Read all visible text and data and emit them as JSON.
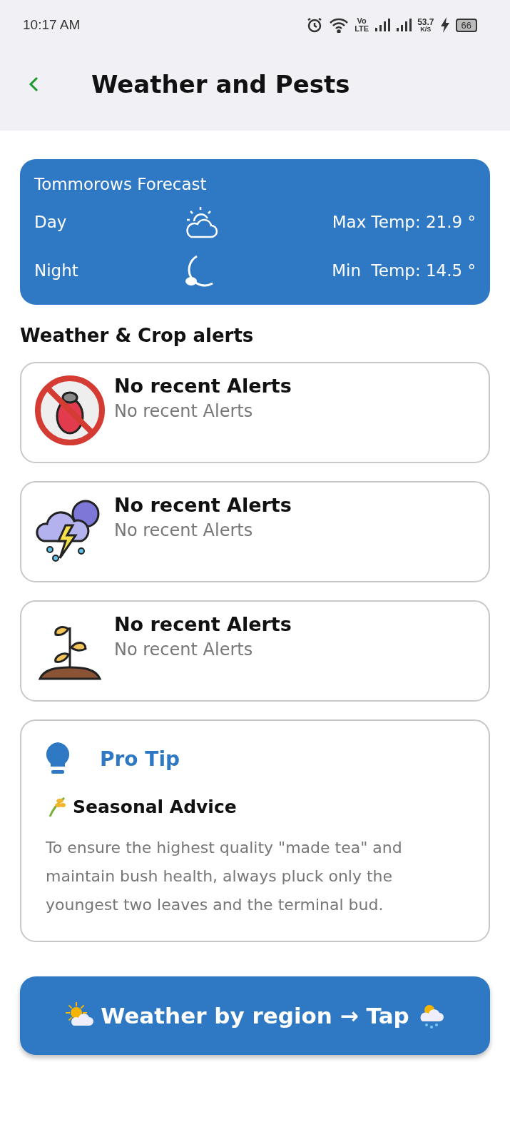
{
  "status_bar": {
    "time": "10:17 AM",
    "network_top": "Vo",
    "network_bottom": "LTE",
    "speed": "53.7",
    "speed_unit": "K/S",
    "battery": "66"
  },
  "header": {
    "title": "Weather and Pests"
  },
  "forecast": {
    "title": "Tommorows Forecast",
    "rows": [
      {
        "kind": "day",
        "label": "Day",
        "reading": "Max Temp: 21.9 °"
      },
      {
        "kind": "night",
        "label": "Night",
        "reading": "Min  Temp: 14.5 °"
      }
    ]
  },
  "alerts_title": "Weather & Crop alerts",
  "alerts": [
    {
      "kind": "pest",
      "title": "No recent Alerts",
      "subtitle": "No recent Alerts"
    },
    {
      "kind": "storm",
      "title": "No recent Alerts",
      "subtitle": "No recent Alerts"
    },
    {
      "kind": "plant",
      "title": "No recent Alerts",
      "subtitle": "No recent Alerts"
    }
  ],
  "pro_tip": {
    "title": "Pro Tip",
    "heading": "Seasonal Advice",
    "text": "To ensure the highest quality \"made tea\" and maintain bush health, always pluck only the youngest two leaves and the terminal bud."
  },
  "region_button": {
    "label": "Weather by region → Tap"
  }
}
